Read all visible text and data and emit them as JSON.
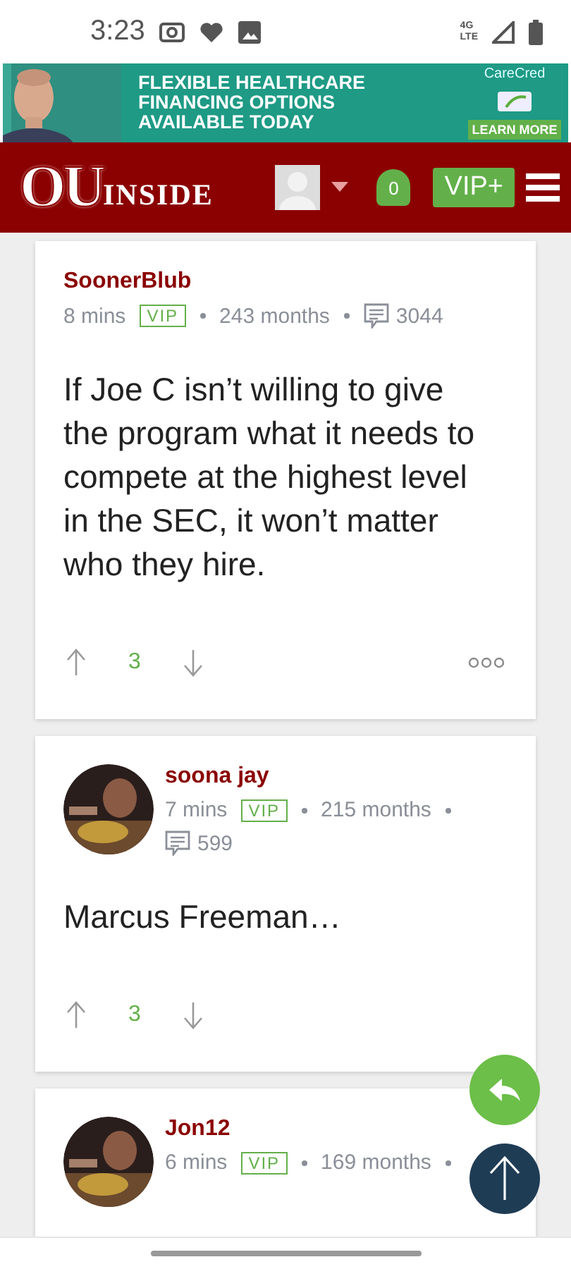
{
  "status_bar": {
    "time": "3:23",
    "network": "4G",
    "network_sub": "LTE"
  },
  "ad": {
    "lines": [
      "FLEXIBLE HEALTHCARE",
      "FINANCING OPTIONS",
      "AVAILABLE TODAY"
    ],
    "brand": "CareCred",
    "cta": "LEARN MORE"
  },
  "header": {
    "logo": "OU",
    "logo_sub": "INSIDE",
    "notifications": "0",
    "vip_button": "VIP+"
  },
  "posts": [
    {
      "author": "SoonerBlub",
      "avatar": false,
      "time": "8 mins",
      "badge": "VIP",
      "tenure": "243 months",
      "comments": "3044",
      "body": "If Joe C isn’t willing to give the program what it needs to compete at the highest level in the SEC, it won’t matter who they hire.",
      "votes": "3",
      "more": true
    },
    {
      "author": "soona jay",
      "avatar": true,
      "time": "7 mins",
      "badge": "VIP",
      "tenure": "215 months",
      "comments": "599",
      "body": "Marcus Freeman…",
      "votes": "3",
      "more": false
    },
    {
      "author": "Jon12",
      "avatar": true,
      "time": "6 mins",
      "badge": "VIP",
      "tenure": "169 months"
    }
  ]
}
